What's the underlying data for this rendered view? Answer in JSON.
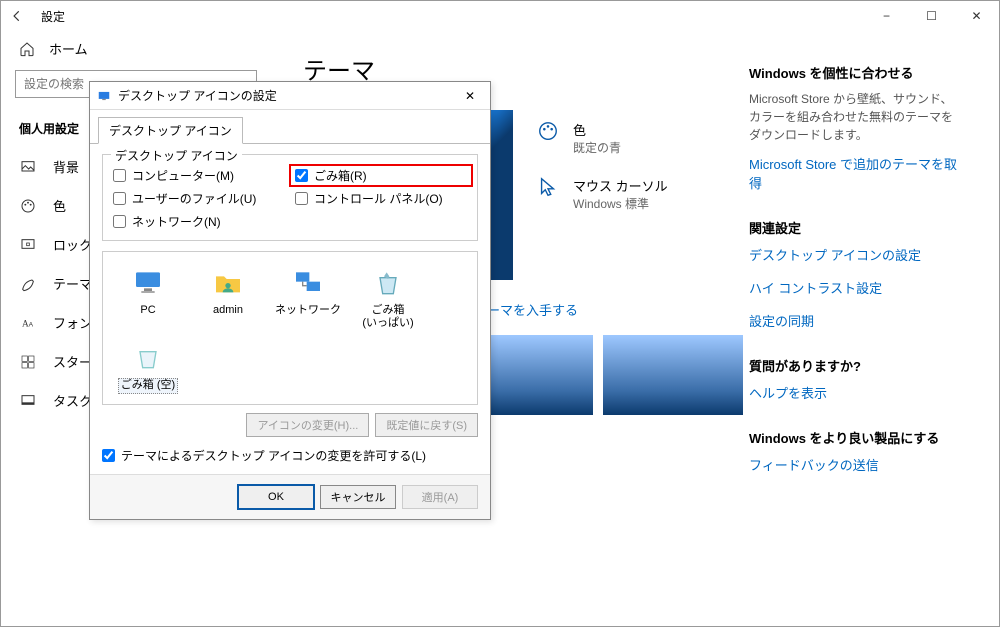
{
  "window": {
    "title": "設定",
    "controls": {
      "minimize": "−",
      "maximize": "☐",
      "close": "✕"
    }
  },
  "sidebar": {
    "home_label": "ホーム",
    "search_placeholder": "設定の検索",
    "group_label": "個人用設定",
    "items": [
      {
        "label": "背景"
      },
      {
        "label": "色"
      },
      {
        "label": "ロック画面"
      },
      {
        "label": "テーマ"
      },
      {
        "label": "フォント"
      },
      {
        "label": "スタート"
      },
      {
        "label": "タスク バー"
      }
    ]
  },
  "page": {
    "title": "テーマ",
    "color": {
      "label": "色",
      "value": "既定の青"
    },
    "cursor": {
      "label": "マウス カーソル",
      "value": "Windows 標準"
    },
    "store_link": "Microsoft Store で追加のテーマを入手する"
  },
  "right": {
    "personalize": {
      "title": "Windows を個性に合わせる",
      "desc": "Microsoft Store から壁紙、サウンド、カラーを組み合わせた無料のテーマをダウンロードします。",
      "link": "Microsoft Store で追加のテーマを取得"
    },
    "related": {
      "title": "関連設定",
      "links": [
        "デスクトップ アイコンの設定",
        "ハイ コントラスト設定",
        "設定の同期"
      ]
    },
    "help": {
      "title": "質問がありますか?",
      "link": "ヘルプを表示"
    },
    "feedback": {
      "title": "Windows をより良い製品にする",
      "link": "フィードバックの送信"
    }
  },
  "dialog": {
    "title": "デスクトップ アイコンの設定",
    "tab": "デスクトップ アイコン",
    "fieldset_legend": "デスクトップ アイコン",
    "checks": {
      "computer": {
        "label": "コンピューター(M)",
        "checked": false
      },
      "recycle": {
        "label": "ごみ箱(R)",
        "checked": true
      },
      "userfiles": {
        "label": "ユーザーのファイル(U)",
        "checked": false
      },
      "controlpanel": {
        "label": "コントロール パネル(O)",
        "checked": false
      },
      "network": {
        "label": "ネットワーク(N)",
        "checked": false
      }
    },
    "icons": [
      {
        "label": "PC",
        "sublabel": ""
      },
      {
        "label": "admin",
        "sublabel": ""
      },
      {
        "label": "ネットワーク",
        "sublabel": ""
      },
      {
        "label": "ごみ箱",
        "sublabel": "(いっぱい)"
      },
      {
        "label": "ごみ箱 (空)",
        "sublabel": ""
      }
    ],
    "btn_change_icon": "アイコンの変更(H)...",
    "btn_reset": "既定値に戻す(S)",
    "allow_theme": "テーマによるデスクトップ アイコンの変更を許可する(L)",
    "allow_theme_checked": true,
    "btn_ok": "OK",
    "btn_cancel": "キャンセル",
    "btn_apply": "適用(A)"
  }
}
